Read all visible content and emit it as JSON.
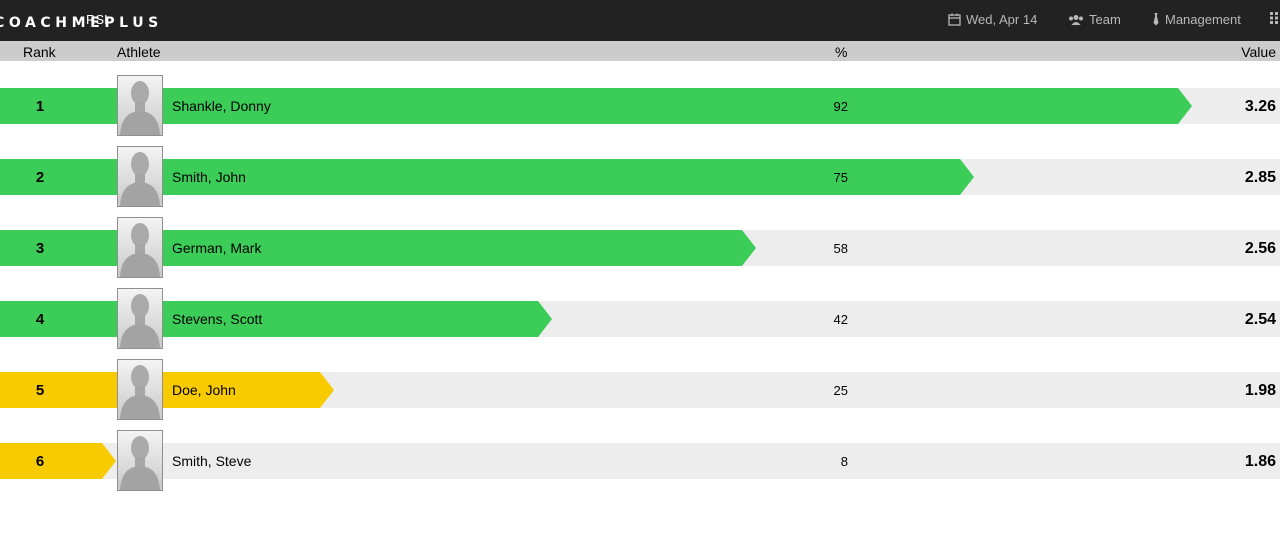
{
  "header": {
    "logo": "COACHMEPLUS",
    "metric": "RSI",
    "date": "Wed, Apr 14",
    "team": "Team",
    "management": "Management"
  },
  "columns": {
    "rank": "Rank",
    "athlete": "Athlete",
    "percent": "%",
    "value": "Value"
  },
  "colors": {
    "high": "#3ccd59",
    "mid": "#f8cb00",
    "track": "#ededed",
    "topbar": "#222222"
  },
  "athletes": [
    {
      "rank": "1",
      "name": "Shankle, Donny",
      "percent": "92",
      "value": "3.26",
      "color": "#3ccd59"
    },
    {
      "rank": "2",
      "name": "Smith, John",
      "percent": "75",
      "value": "2.85",
      "color": "#3ccd59"
    },
    {
      "rank": "3",
      "name": "German, Mark",
      "percent": "58",
      "value": "2.56",
      "color": "#3ccd59"
    },
    {
      "rank": "4",
      "name": "Stevens, Scott",
      "percent": "42",
      "value": "2.54",
      "color": "#3ccd59"
    },
    {
      "rank": "5",
      "name": "Doe, John",
      "percent": "25",
      "value": "1.98",
      "color": "#f8cb00"
    },
    {
      "rank": "6",
      "name": "Smith, Steve",
      "percent": "8",
      "value": "1.86",
      "color": "#f8cb00"
    }
  ]
}
